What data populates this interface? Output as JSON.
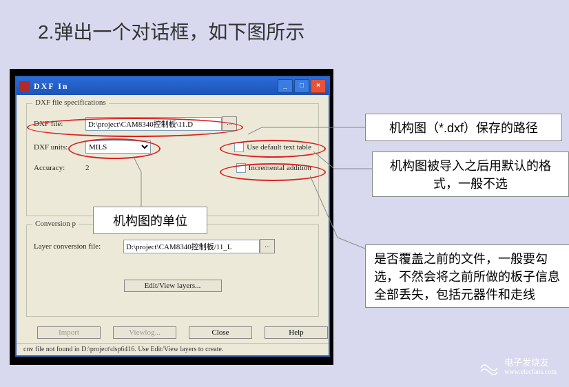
{
  "heading": "2.弹出一个对话框，如下图所示",
  "win": {
    "title": "DXF In",
    "group1": {
      "title": "DXF file specifications",
      "file_lbl": "DXF file:",
      "file_val": "D:\\project\\CAM8340控制板\\11.D",
      "browse": "...",
      "units_lbl": "DXF units:",
      "units_val": "MILS",
      "acc_lbl": "Accuracy:",
      "acc_val": "2",
      "chk1": "Use default text table",
      "chk2": "Incremental addition"
    },
    "group2": {
      "title": "Conversion p",
      "layer_lbl": "Layer conversion file:",
      "layer_val": "D:\\project\\CAM8340控制板/11_L",
      "browse": "...",
      "edit_btn": "Edit/View layers..."
    },
    "btns": {
      "import": "Import",
      "viewlog": "Viewlog...",
      "close": "Close",
      "help": "Help"
    },
    "status": "cnv file not found in D:\\project\\dsp6416. Use Edit/View layers to create."
  },
  "ann": {
    "a1": "机构图（*.dxf）保存的路径",
    "a2": "机构图被导入之后用默认的格式，一般不选",
    "a3": "机构图的单位",
    "a4": "是否覆盖之前的文件，一般要勾选，不然会将之前所做的板子信息全部丢失，包括元器件和走线"
  },
  "logo": {
    "brand": "电子发烧友",
    "url": "www.elecfans.com"
  }
}
